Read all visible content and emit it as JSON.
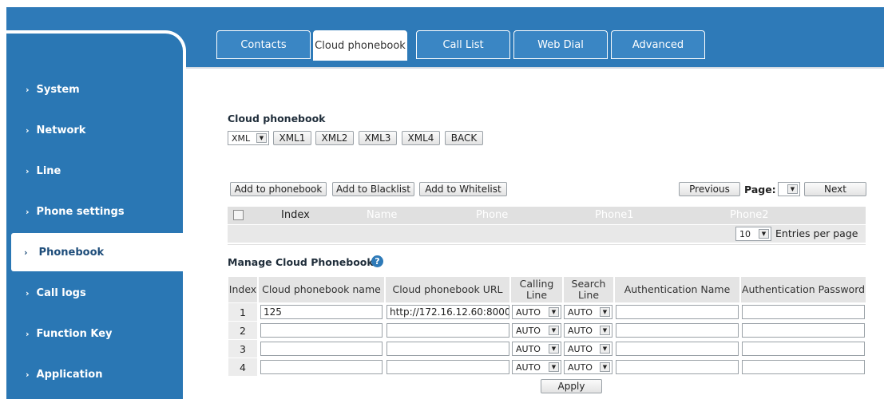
{
  "sidebar": {
    "items": [
      {
        "label": "System",
        "active": false
      },
      {
        "label": "Network",
        "active": false
      },
      {
        "label": "Line",
        "active": false
      },
      {
        "label": "Phone settings",
        "active": false
      },
      {
        "label": "Phonebook",
        "active": true
      },
      {
        "label": "Call logs",
        "active": false
      },
      {
        "label": "Function Key",
        "active": false
      },
      {
        "label": "Application",
        "active": false
      }
    ]
  },
  "tabs": [
    {
      "label": "Contacts",
      "active": false
    },
    {
      "label": "Cloud phonebook",
      "active": true
    },
    {
      "label": "Call List",
      "active": false
    },
    {
      "label": "Web Dial",
      "active": false
    },
    {
      "label": "Advanced",
      "active": false
    }
  ],
  "cloud_phonebook": {
    "title": "Cloud phonebook",
    "select_value": "XML",
    "buttons": [
      "XML1",
      "XML2",
      "XML3",
      "XML4",
      "BACK"
    ]
  },
  "contacts_toolbar": {
    "add_phonebook": "Add to phonebook",
    "add_blacklist": "Add to Blacklist",
    "add_whitelist": "Add to Whitelist",
    "previous": "Previous",
    "page_label": "Page:",
    "page_value": "",
    "next": "Next"
  },
  "contacts_table": {
    "columns": [
      "Index",
      "Name",
      "Phone",
      "Phone1",
      "Phone2"
    ],
    "entries_per_page_value": "10",
    "entries_per_page_label": "Entries per page"
  },
  "manage": {
    "title": "Manage Cloud Phonebooks",
    "columns": [
      "Index",
      "Cloud phonebook name",
      "Cloud phonebook URL",
      "Calling Line",
      "Search Line",
      "Authentication Name",
      "Authentication Password"
    ],
    "rows": [
      {
        "index": "1",
        "name": "125",
        "url": "http://172.16.12.60:8000",
        "calling_line": "AUTO",
        "search_line": "AUTO",
        "auth_name": "",
        "auth_password": ""
      },
      {
        "index": "2",
        "name": "",
        "url": "",
        "calling_line": "AUTO",
        "search_line": "AUTO",
        "auth_name": "",
        "auth_password": ""
      },
      {
        "index": "3",
        "name": "",
        "url": "",
        "calling_line": "AUTO",
        "search_line": "AUTO",
        "auth_name": "",
        "auth_password": ""
      },
      {
        "index": "4",
        "name": "",
        "url": "",
        "calling_line": "AUTO",
        "search_line": "AUTO",
        "auth_name": "",
        "auth_password": ""
      }
    ],
    "apply": "Apply"
  },
  "colors": {
    "brand_blue": "#2a77b4",
    "help_icon": "#2e7ab8"
  }
}
